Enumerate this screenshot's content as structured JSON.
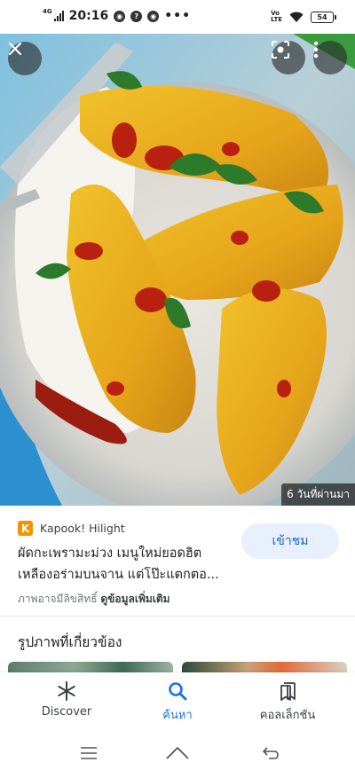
{
  "status_bar": {
    "time": "20:16",
    "network": "4G",
    "volte_top": "Vo",
    "volte_bottom": "LTE",
    "battery": "54"
  },
  "image": {
    "time_ago": "6 วันที่ผ่านมา"
  },
  "result": {
    "source_logo": "K",
    "source_name": "Kapook! Hilight",
    "title": "ผัดกะเพรามะม่วง เมนูใหม่ยอดฮิต เหลืองอร่ามบนจาน แต่โป๊ะแตกตอ...",
    "visit_label": "เข้าชม",
    "copyright_text": "ภาพอาจมีลิขสิทธิ์",
    "details_link": "ดูข้อมูลเพิ่มเติม"
  },
  "related": {
    "title": "รูปภาพที่เกี่ยวข้อง"
  },
  "bottom_nav": {
    "items": [
      {
        "label": "Discover",
        "icon": "asterisk-icon"
      },
      {
        "label": "ค้นหา",
        "icon": "search-icon"
      },
      {
        "label": "คอลเล็กชัน",
        "icon": "collections-icon"
      }
    ],
    "active_color": "#1a73e8"
  }
}
